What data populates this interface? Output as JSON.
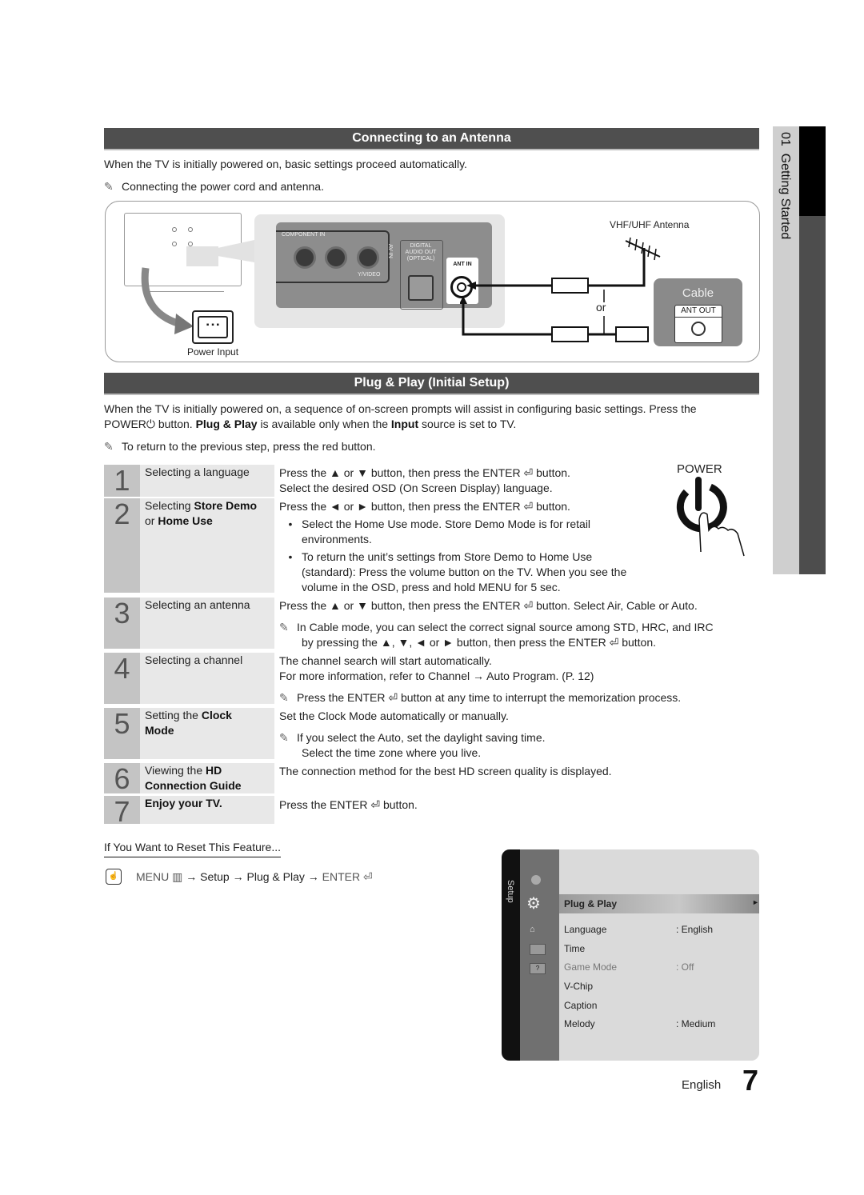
{
  "side_tab": {
    "chapter": "01",
    "title": "Getting Started"
  },
  "antenna_section": {
    "heading": "Connecting to an Antenna",
    "intro": "When the TV is initially powered on, basic settings proceed automatically.",
    "note": "Connecting the power cord and antenna.",
    "diagram": {
      "power_input_label": "Power Input",
      "component_in_label": "COMPONENT IN",
      "av_in_label": "AV IN",
      "digital_audio_label_1": "DIGITAL",
      "digital_audio_label_2": "AUDIO OUT",
      "digital_audio_label_3": "(OPTICAL)",
      "video_label": "Y/VIDEO",
      "ant_in_label": "ANT IN",
      "antenna_label": "VHF/UHF Antenna",
      "or_label": "or",
      "cable_label": "Cable",
      "ant_out_label": "ANT OUT"
    }
  },
  "plug_play_section": {
    "heading": "Plug & Play (Initial Setup)",
    "intro_line1": "When the TV is initially powered on, a sequence of on-screen prompts will assist in configuring basic settings. Press the",
    "intro_line2_a": "POWER",
    "intro_line2_b": " button. ",
    "intro_line2_c": "Plug & Play",
    "intro_line2_d": " is available only when the ",
    "intro_line2_e": "Input",
    "intro_line2_f": " source is set to TV.",
    "note": "To return to the previous step, press the red button.",
    "power_label": "POWER"
  },
  "steps": [
    {
      "num": "1",
      "title": "Selecting a language",
      "lines": [
        "Press the ▲ or ▼ button, then press the ENTER ⏎ button.",
        "Select the desired OSD (On Screen Display) language."
      ]
    },
    {
      "num": "2",
      "title_a": "Selecting ",
      "title_b": "Store Demo",
      "title_c": "or ",
      "title_d": "Home Use",
      "lines": [
        "Press the ◄ or ► button, then press the ENTER ⏎ button.",
        "Select the Home Use mode. Store Demo Mode is for retail",
        "environments.",
        "To return the unit’s settings from Store Demo to Home Use",
        "(standard): Press the volume button on the TV. When you see the",
        "volume in the OSD, press and hold MENU for 5 sec."
      ]
    },
    {
      "num": "3",
      "title": "Selecting an antenna",
      "lines": [
        "Press the ▲ or ▼ button, then press the ENTER ⏎ button. Select Air, Cable or Auto.",
        "In Cable mode, you can select the correct signal source among STD, HRC, and IRC",
        "by pressing the ▲, ▼, ◄ or ► button, then press the ENTER ⏎ button."
      ]
    },
    {
      "num": "4",
      "title": "Selecting a channel",
      "lines": [
        "The channel search will start automatically.",
        "For more information, refer to Channel → Auto Program. (P. 12)",
        "Press the ENTER ⏎ button at any time to interrupt the memorization process."
      ]
    },
    {
      "num": "5",
      "title_a": "Setting the ",
      "title_b": "Clock",
      "title_c": "Mode",
      "lines": [
        "Set the Clock Mode automatically or manually.",
        "If you select the Auto, set the daylight saving time.",
        "Select the time zone where you live."
      ]
    },
    {
      "num": "6",
      "title_a": "Viewing the ",
      "title_b": "HD",
      "title_c": "Connection Guide",
      "lines": [
        "The connection method for the best HD screen quality is displayed."
      ]
    },
    {
      "num": "7",
      "title": "Enjoy your TV.",
      "lines": [
        "Press the ENTER ⏎ button."
      ]
    }
  ],
  "reset": {
    "heading": "If You Want to Reset This Feature...",
    "path": [
      "MENU ▥",
      "Setup",
      "Plug & Play",
      "ENTER ⏎"
    ],
    "arrow": "→"
  },
  "osd_menu": {
    "side_label": "Setup",
    "selected": "Plug & Play",
    "items": [
      {
        "label": "Language",
        "value": ": English",
        "disabled": false
      },
      {
        "label": "Time",
        "value": "",
        "disabled": false
      },
      {
        "label": "Game Mode",
        "value": ": Off",
        "disabled": true
      },
      {
        "label": "V-Chip",
        "value": "",
        "disabled": false
      },
      {
        "label": "Caption",
        "value": "",
        "disabled": false
      },
      {
        "label": "Melody",
        "value": ": Medium",
        "disabled": false
      }
    ]
  },
  "footer": {
    "language": "English",
    "page": "7"
  }
}
